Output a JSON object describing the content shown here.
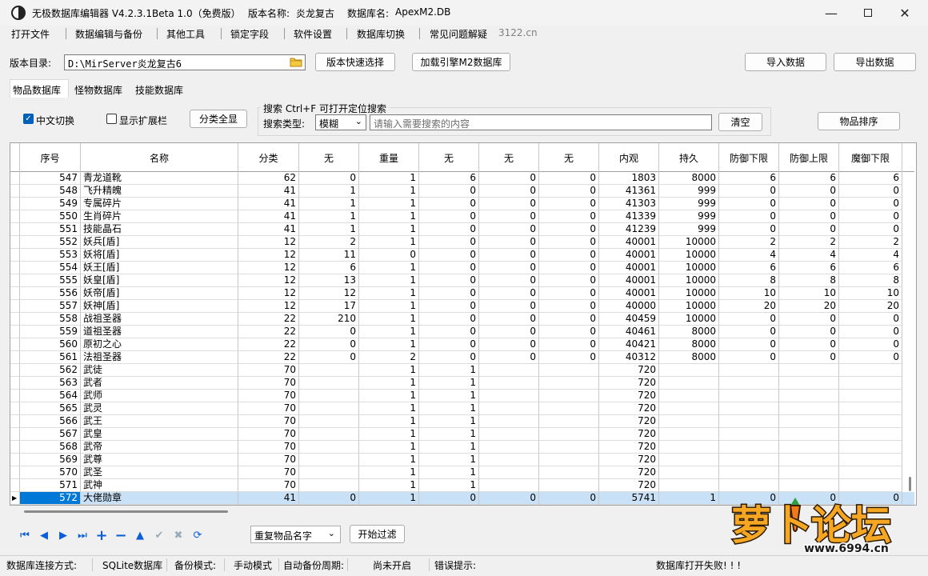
{
  "title": {
    "app_name": "无极数据库编辑器 V4.2.3.1",
    "edition": "Beta 1.0（免费版）",
    "version_label": "版本名称:",
    "version_name": "炎龙复古",
    "db_label": "数据库名:",
    "db_name": "ApexM2.DB"
  },
  "menu": [
    "打开文件",
    "数据编辑与备份",
    "其他工具",
    "锁定字段",
    "软件设置",
    "数据库切换",
    "常见问题解疑",
    "3122.cn"
  ],
  "toolbar": {
    "dir_label": "版本目录:",
    "dir_value": "D:\\MirServer炎龙复古6",
    "quick_select": "版本快速选择",
    "load_engine": "加载引擎M2数据库",
    "import": "导入数据",
    "export": "导出数据"
  },
  "tabs": [
    "物品数据库",
    "怪物数据库",
    "技能数据库"
  ],
  "panel": {
    "cn_switch": "中文切换",
    "show_ext": "显示扩展栏",
    "show_all": "分类全显",
    "search_title": "搜索   Ctrl+F 可打开定位搜索",
    "search_type_label": "搜索类型:",
    "search_type": "模糊",
    "search_placeholder": "请输入需要搜索的内容",
    "clear": "清空",
    "sort": "物品排序"
  },
  "grid": {
    "columns": [
      "序号",
      "名称",
      "分类",
      "无",
      "重量",
      "无",
      "无",
      "无",
      "内观",
      "持久",
      "防御下限",
      "防御上限",
      "魔御下限"
    ],
    "rows": [
      [
        "547",
        "青龙道靴",
        "62",
        "0",
        "1",
        "6",
        "0",
        "0",
        "1803",
        "8000",
        "6",
        "6",
        "6"
      ],
      [
        "548",
        "飞升精魄",
        "41",
        "1",
        "1",
        "0",
        "0",
        "0",
        "41361",
        "999",
        "0",
        "0",
        "0"
      ],
      [
        "549",
        "专属碎片",
        "41",
        "1",
        "1",
        "0",
        "0",
        "0",
        "41303",
        "999",
        "0",
        "0",
        "0"
      ],
      [
        "550",
        "生肖碎片",
        "41",
        "1",
        "1",
        "0",
        "0",
        "0",
        "41339",
        "999",
        "0",
        "0",
        "0"
      ],
      [
        "551",
        "技能晶石",
        "41",
        "1",
        "1",
        "0",
        "0",
        "0",
        "41239",
        "999",
        "0",
        "0",
        "0"
      ],
      [
        "552",
        "妖兵[盾]",
        "12",
        "2",
        "1",
        "0",
        "0",
        "0",
        "40001",
        "10000",
        "2",
        "2",
        "2"
      ],
      [
        "553",
        "妖将[盾]",
        "12",
        "11",
        "0",
        "0",
        "0",
        "0",
        "40001",
        "10000",
        "4",
        "4",
        "4"
      ],
      [
        "554",
        "妖王[盾]",
        "12",
        "6",
        "1",
        "0",
        "0",
        "0",
        "40001",
        "10000",
        "6",
        "6",
        "6"
      ],
      [
        "555",
        "妖皇[盾]",
        "12",
        "13",
        "1",
        "0",
        "0",
        "0",
        "40001",
        "10000",
        "8",
        "8",
        "8"
      ],
      [
        "556",
        "妖帝[盾]",
        "12",
        "12",
        "1",
        "0",
        "0",
        "0",
        "40001",
        "10000",
        "10",
        "10",
        "10"
      ],
      [
        "557",
        "妖神[盾]",
        "12",
        "17",
        "1",
        "0",
        "0",
        "0",
        "40000",
        "10000",
        "20",
        "20",
        "20"
      ],
      [
        "558",
        "战祖圣器",
        "22",
        "210",
        "1",
        "0",
        "0",
        "0",
        "40459",
        "10000",
        "0",
        "0",
        "0"
      ],
      [
        "559",
        "道祖圣器",
        "22",
        "0",
        "1",
        "0",
        "0",
        "0",
        "40461",
        "8000",
        "0",
        "0",
        "0"
      ],
      [
        "560",
        "原初之心",
        "22",
        "0",
        "1",
        "0",
        "0",
        "0",
        "40421",
        "8000",
        "0",
        "0",
        "0"
      ],
      [
        "561",
        "法祖圣器",
        "22",
        "0",
        "2",
        "0",
        "0",
        "0",
        "40312",
        "8000",
        "0",
        "0",
        "0"
      ],
      [
        "562",
        "武徒",
        "70",
        "",
        "1",
        "1",
        "",
        "",
        "720",
        "",
        "",
        "",
        ""
      ],
      [
        "563",
        "武者",
        "70",
        "",
        "1",
        "1",
        "",
        "",
        "720",
        "",
        "",
        "",
        ""
      ],
      [
        "564",
        "武师",
        "70",
        "",
        "1",
        "1",
        "",
        "",
        "720",
        "",
        "",
        "",
        ""
      ],
      [
        "565",
        "武灵",
        "70",
        "",
        "1",
        "1",
        "",
        "",
        "720",
        "",
        "",
        "",
        ""
      ],
      [
        "566",
        "武王",
        "70",
        "",
        "1",
        "1",
        "",
        "",
        "720",
        "",
        "",
        "",
        ""
      ],
      [
        "567",
        "武皇",
        "70",
        "",
        "1",
        "1",
        "",
        "",
        "720",
        "",
        "",
        "",
        ""
      ],
      [
        "568",
        "武帝",
        "70",
        "",
        "1",
        "1",
        "",
        "",
        "720",
        "",
        "",
        "",
        ""
      ],
      [
        "569",
        "武尊",
        "70",
        "",
        "1",
        "1",
        "",
        "",
        "720",
        "",
        "",
        "",
        ""
      ],
      [
        "570",
        "武圣",
        "70",
        "",
        "1",
        "1",
        "",
        "",
        "720",
        "",
        "",
        "",
        ""
      ],
      [
        "571",
        "武神",
        "70",
        "",
        "1",
        "1",
        "",
        "",
        "720",
        "",
        "",
        "",
        ""
      ],
      [
        "572",
        "大佬勋章",
        "41",
        "0",
        "1",
        "0",
        "0",
        "0",
        "5741",
        "1",
        "0",
        "0",
        "0"
      ]
    ]
  },
  "bottom": {
    "dup_select": "重复物品名字",
    "filter": "开始过滤"
  },
  "status": {
    "conn_label": "数据库连接方式:",
    "conn_value": "SQLite数据库",
    "backup_label": "备份模式:",
    "backup_value": "手动模式",
    "auto_label": "自动备份周期:",
    "auto_value": "尚未开启",
    "err_label": "错误提示:",
    "err_value": "数据库打开失败! ! !"
  },
  "logo": {
    "text": "萝卜论坛",
    "url": "www.6994.cn"
  },
  "colors": {
    "accent": "#005fb8",
    "selected_row": "#c9e1f7",
    "logo_orange": "#f5a623"
  }
}
